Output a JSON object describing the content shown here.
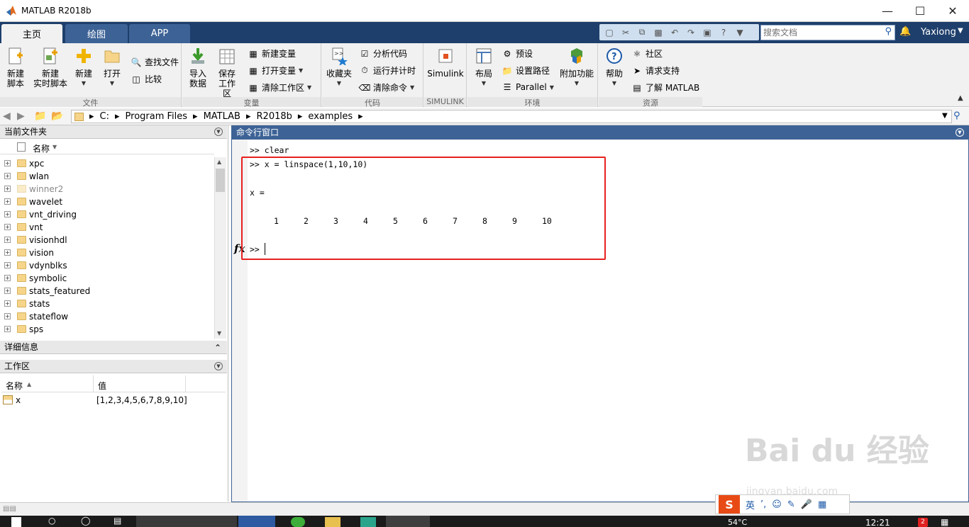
{
  "window": {
    "title": "MATLAB R2018b"
  },
  "tabs": [
    {
      "label": "主页"
    },
    {
      "label": "绘图"
    },
    {
      "label": "APP"
    }
  ],
  "search": {
    "placeholder": "搜索文档"
  },
  "user": {
    "name": "Yaxiong"
  },
  "ribbon": {
    "file": {
      "label": "文件",
      "new_script": "新建\n脚本",
      "new_live": "新建\n实时脚本",
      "new": "新建",
      "open": "打开",
      "find_files": "查找文件",
      "compare": "比较"
    },
    "variable": {
      "label": "变量",
      "import": "导入\n数据",
      "save_ws": "保存\n工作区",
      "new_var": "新建变量",
      "open_var": "打开变量",
      "clear_ws": "清除工作区"
    },
    "code": {
      "label": "代码",
      "favorites": "收藏夹",
      "analyze": "分析代码",
      "run_time": "运行并计时",
      "clear_cmd": "清除命令"
    },
    "simulink": {
      "label": "SIMULINK",
      "simulink": "Simulink"
    },
    "env": {
      "label": "环境",
      "layout": "布局",
      "prefs": "预设",
      "set_path": "设置路径",
      "parallel": "Parallel",
      "addons": "附加功能"
    },
    "resources": {
      "label": "资源",
      "help": "帮助",
      "community": "社区",
      "support": "请求支持",
      "learn": "了解 MATLAB"
    }
  },
  "path": {
    "crumbs": [
      "C:",
      "Program Files",
      "MATLAB",
      "R2018b",
      "examples"
    ]
  },
  "current_folder": {
    "title": "当前文件夹",
    "col_name": "名称",
    "items": [
      "xpc",
      "wlan",
      "winner2",
      "wavelet",
      "vnt_driving",
      "vnt",
      "visionhdl",
      "vision",
      "vdynblks",
      "symbolic",
      "stats_featured",
      "stats",
      "stateflow",
      "sps"
    ]
  },
  "details": {
    "title": "详细信息"
  },
  "workspace": {
    "title": "工作区",
    "col_name": "名称",
    "col_value": "值",
    "rows": [
      {
        "name": "x",
        "value": "[1,2,3,4,5,6,7,8,9,10]"
      }
    ]
  },
  "command": {
    "title": "命令行窗口",
    "lines": [
      ">> clear",
      ">> x = linspace(1,10,10)",
      "x ="
    ],
    "values": [
      "1",
      "2",
      "3",
      "4",
      "5",
      "6",
      "7",
      "8",
      "9",
      "10"
    ],
    "prompt": ">>",
    "fx": "fx"
  },
  "ime": {
    "lang": "英"
  },
  "taskbar": {
    "temp": "54°C",
    "time": "12:21",
    "badge": "2"
  },
  "watermark": {
    "logo": "Bai du 经验",
    "url": "jingyan.baidu.com"
  }
}
